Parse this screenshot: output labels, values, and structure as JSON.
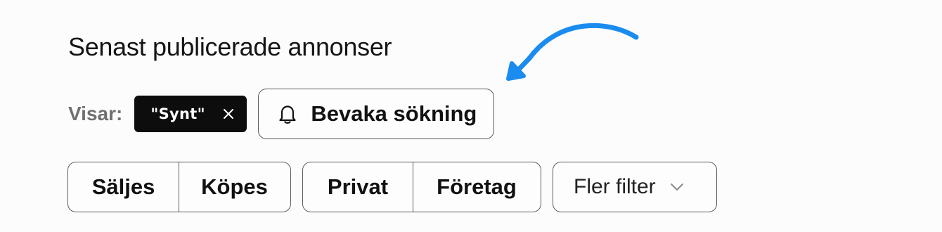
{
  "heading": "Senast publicerade annonser",
  "active_search": {
    "label": "Visar:",
    "chip_text": "\"Synt\"",
    "remove_icon": "close-icon"
  },
  "watch_search": {
    "label": "Bevaka sökning",
    "icon": "bell-icon"
  },
  "annotation": {
    "icon": "curved-arrow-icon",
    "color": "#1a8cf0"
  },
  "filters": {
    "type_group": [
      "Säljes",
      "Köpes"
    ],
    "seller_group": [
      "Privat",
      "Företag"
    ],
    "more": {
      "label": "Fler filter",
      "icon": "chevron-down-icon"
    }
  }
}
